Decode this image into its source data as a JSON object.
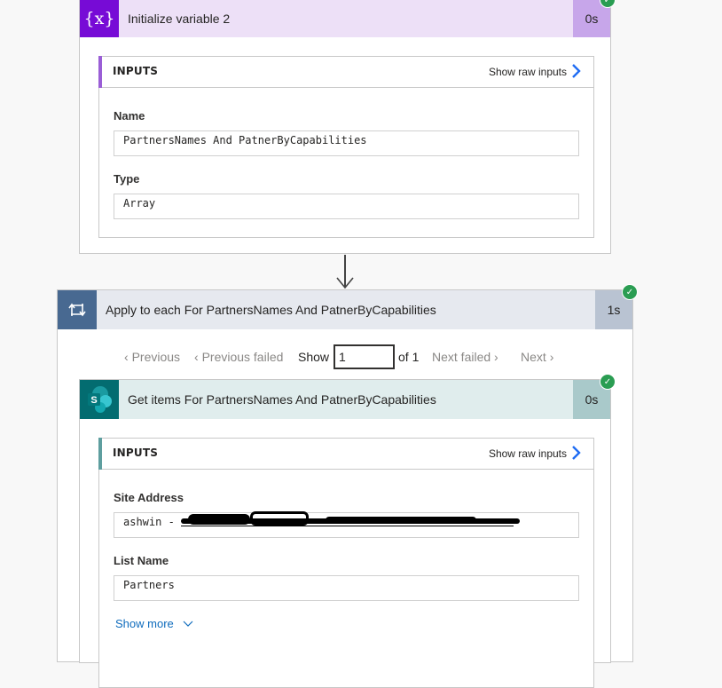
{
  "actions": [
    {
      "title": "Initialize variable 2",
      "duration": "0s",
      "icon": "variable-icon",
      "icon_glyph": "{x}",
      "status": "succeeded",
      "colors": {
        "icon_bg": "#770bd6",
        "header_bg": "#ede0f7",
        "duration_bg": "#c7a6ea",
        "accent": "#9a5ed6"
      },
      "inputs": {
        "label": "INPUTS",
        "raw_link": "Show raw inputs",
        "fields": [
          {
            "label": "Name",
            "value": "PartnersNames And PatnerByCapabilities"
          },
          {
            "label": "Type",
            "value": "Array"
          }
        ]
      }
    },
    {
      "title": "Apply to each For PartnersNames And PatnerByCapabilities",
      "duration": "1s",
      "icon": "loop-icon",
      "status": "succeeded",
      "colors": {
        "icon_bg": "#486991",
        "header_bg": "#e6e9ef",
        "duration_bg": "#b9c3d2"
      },
      "pager": {
        "previous": "Previous",
        "previous_failed": "Previous failed",
        "show_label": "Show",
        "current": "1",
        "of_label": "of 1",
        "next_failed": "Next failed",
        "next": "Next"
      },
      "children": [
        {
          "title": "Get items For PartnersNames And PatnerByCapabilities",
          "duration": "0s",
          "icon": "sharepoint-icon",
          "icon_glyph": "S",
          "status": "succeeded",
          "colors": {
            "icon_bg": "#036c70",
            "header_bg": "#e0eded",
            "duration_bg": "#a9c9ca",
            "accent": "#5e9e9f"
          },
          "inputs": {
            "label": "INPUTS",
            "raw_link": "Show raw inputs",
            "fields": [
              {
                "label": "Site Address",
                "value": "ashwin - "
              },
              {
                "label": "List Name",
                "value": "Partners"
              }
            ],
            "show_more": "Show more"
          }
        }
      ]
    }
  ]
}
